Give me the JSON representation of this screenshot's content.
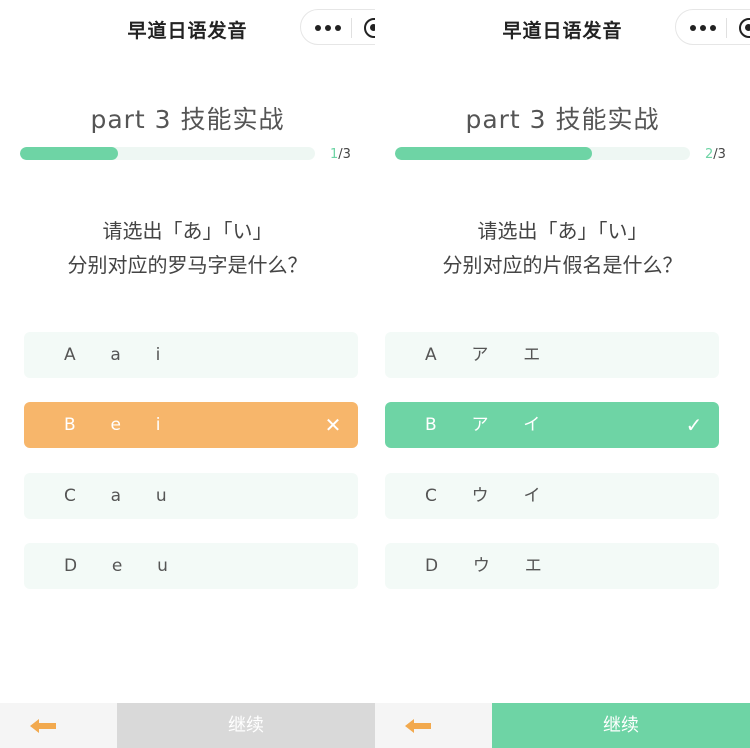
{
  "colors": {
    "accent": "#6ed4a5",
    "wrong": "#f7b66b",
    "option_bg": "#f3faf7",
    "disabled": "#d9d9d9"
  },
  "panels": [
    {
      "app_title": "早道日语发音",
      "part_title": "part 3 技能实战",
      "progress": {
        "current": "1",
        "total": "/3",
        "fraction": 0.333
      },
      "question": {
        "line1": "请选出「あ」「い」",
        "line2": "分别对应的罗马字是什么？"
      },
      "options": [
        {
          "label": "A  a  i",
          "state": "normal"
        },
        {
          "label": "B  e  i",
          "state": "wrong",
          "icon": "close-icon"
        },
        {
          "label": "C  a  u",
          "state": "normal"
        },
        {
          "label": "D  e  u",
          "state": "normal"
        }
      ],
      "continue_label": "继续",
      "continue_state": "disabled",
      "back_icon": "back-arrow-icon"
    },
    {
      "app_title": "早道日语发音",
      "part_title": "part 3 技能实战",
      "progress": {
        "current": "2",
        "total": "/3",
        "fraction": 0.667
      },
      "question": {
        "line1": "请选出「あ」「い」",
        "line2": "分别对应的片假名是什么？"
      },
      "options": [
        {
          "label": "A  ア  エ",
          "state": "normal"
        },
        {
          "label": "B  ア  イ",
          "state": "correct",
          "icon": "check-icon"
        },
        {
          "label": "C  ウ  イ",
          "state": "normal"
        },
        {
          "label": "D  ウ  エ",
          "state": "normal"
        }
      ],
      "continue_label": "继续",
      "continue_state": "enabled",
      "back_icon": "back-arrow-icon"
    }
  ]
}
